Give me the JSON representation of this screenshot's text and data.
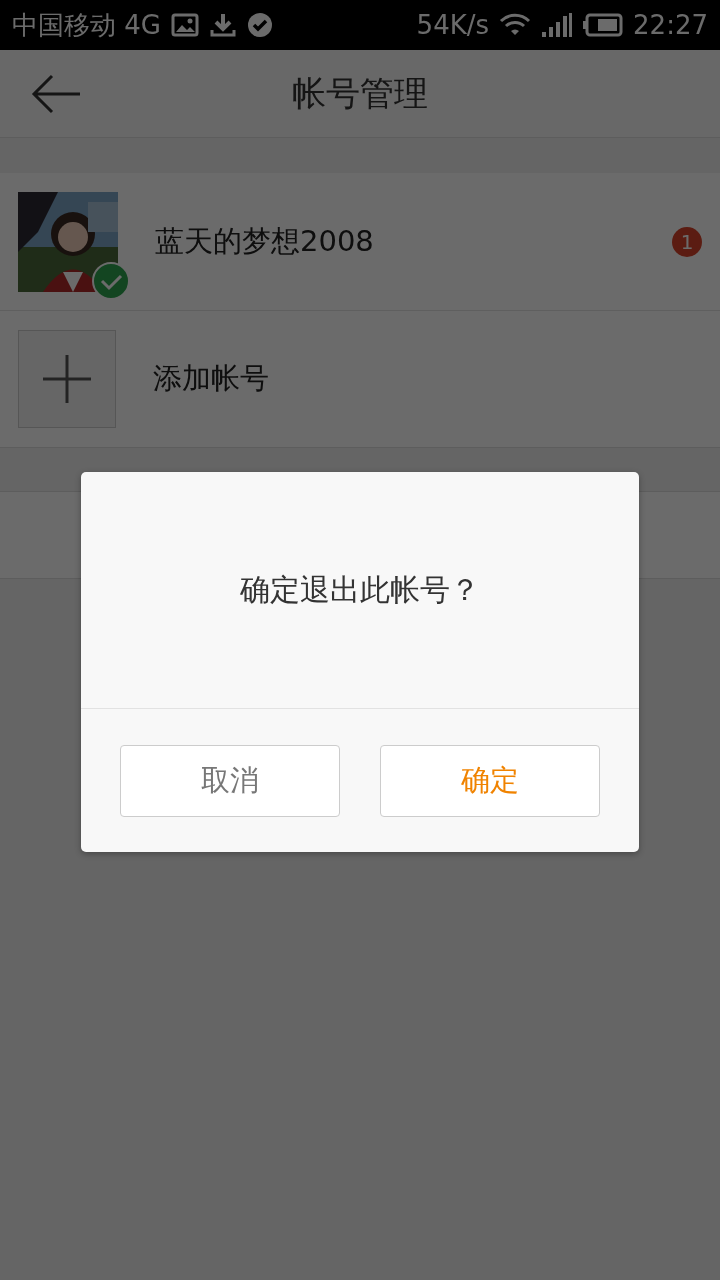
{
  "status_bar": {
    "carrier": "中国移动 4G",
    "speed": "54K/s",
    "time": "22:27"
  },
  "header": {
    "title": "帐号管理"
  },
  "accounts": [
    {
      "kind": "account",
      "name": "蓝天的梦想2008",
      "current": true,
      "badge": "1"
    },
    {
      "kind": "add",
      "name": "添加帐号"
    }
  ],
  "dialog": {
    "message": "确定退出此帐号？",
    "buttons": [
      {
        "label": "取消",
        "kind": "cancel"
      },
      {
        "label": "确定",
        "kind": "confirm"
      }
    ]
  }
}
